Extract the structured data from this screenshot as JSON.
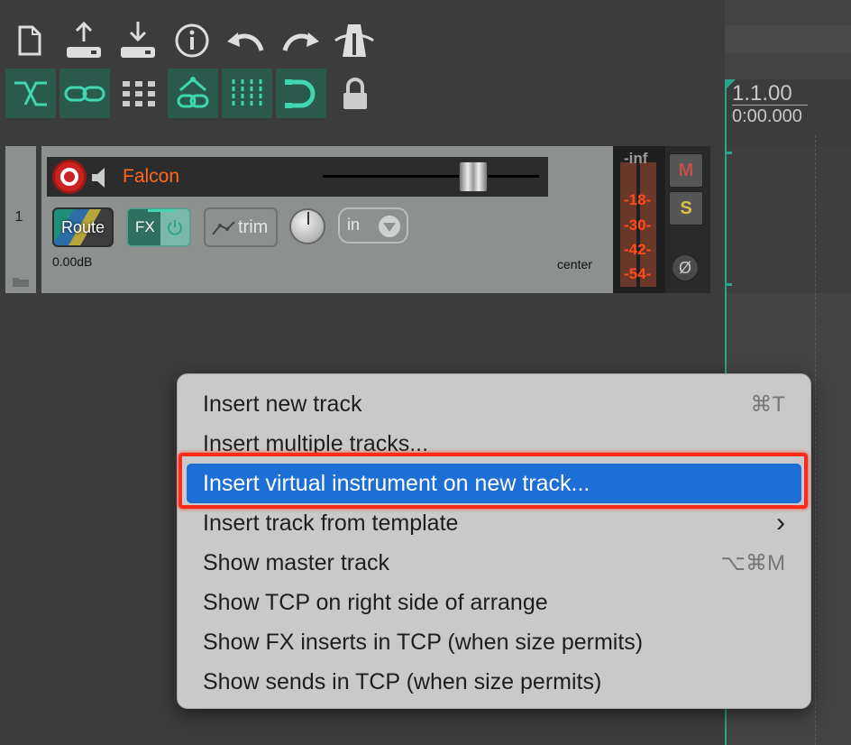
{
  "toolbar": {
    "row1": [
      "new-project-icon",
      "save-upload-icon",
      "download-icon",
      "info-icon",
      "undo-icon",
      "redo-icon",
      "metronome-icon"
    ],
    "row2": [
      "crossfade-icon",
      "link-icon",
      "grid-icon",
      "ripple-link-icon",
      "grid-lines-icon",
      "snap-magnet-icon",
      "lock-icon"
    ]
  },
  "ruler": {
    "bars": "1.1.00",
    "time": "0:00.000"
  },
  "track": {
    "number": "1",
    "name": "Falcon",
    "volume": "0.00dB",
    "pan": "center",
    "route_label": "Route",
    "fx_label": "FX",
    "trim_label": "trim",
    "input_label": "in",
    "meter_labels": [
      "-inf",
      "-18-",
      "-30-",
      "-42-",
      "-54-"
    ],
    "mute_label": "M",
    "solo_label": "S",
    "phase_label": "Ø"
  },
  "menu": {
    "items": [
      {
        "label": "Insert new track",
        "shortcut": "⌘T"
      },
      {
        "label": "Insert multiple tracks...",
        "shortcut": ""
      },
      {
        "label": "Insert virtual instrument on new track...",
        "shortcut": ""
      },
      {
        "label": "Insert track from template",
        "shortcut": "›"
      },
      {
        "label": "Show master track",
        "shortcut": "⌥⌘M"
      },
      {
        "label": "Show TCP on right side of arrange",
        "shortcut": ""
      },
      {
        "label": "Show FX inserts in TCP (when size permits)",
        "shortcut": ""
      },
      {
        "label": "Show sends in TCP (when size permits)",
        "shortcut": ""
      }
    ],
    "highlighted_index": 2
  },
  "colors": {
    "accent": "#2aa58a",
    "menu_highlight": "#1d6fd6",
    "annotation": "#ff2a1a",
    "track_name": "#ff6a1a"
  }
}
